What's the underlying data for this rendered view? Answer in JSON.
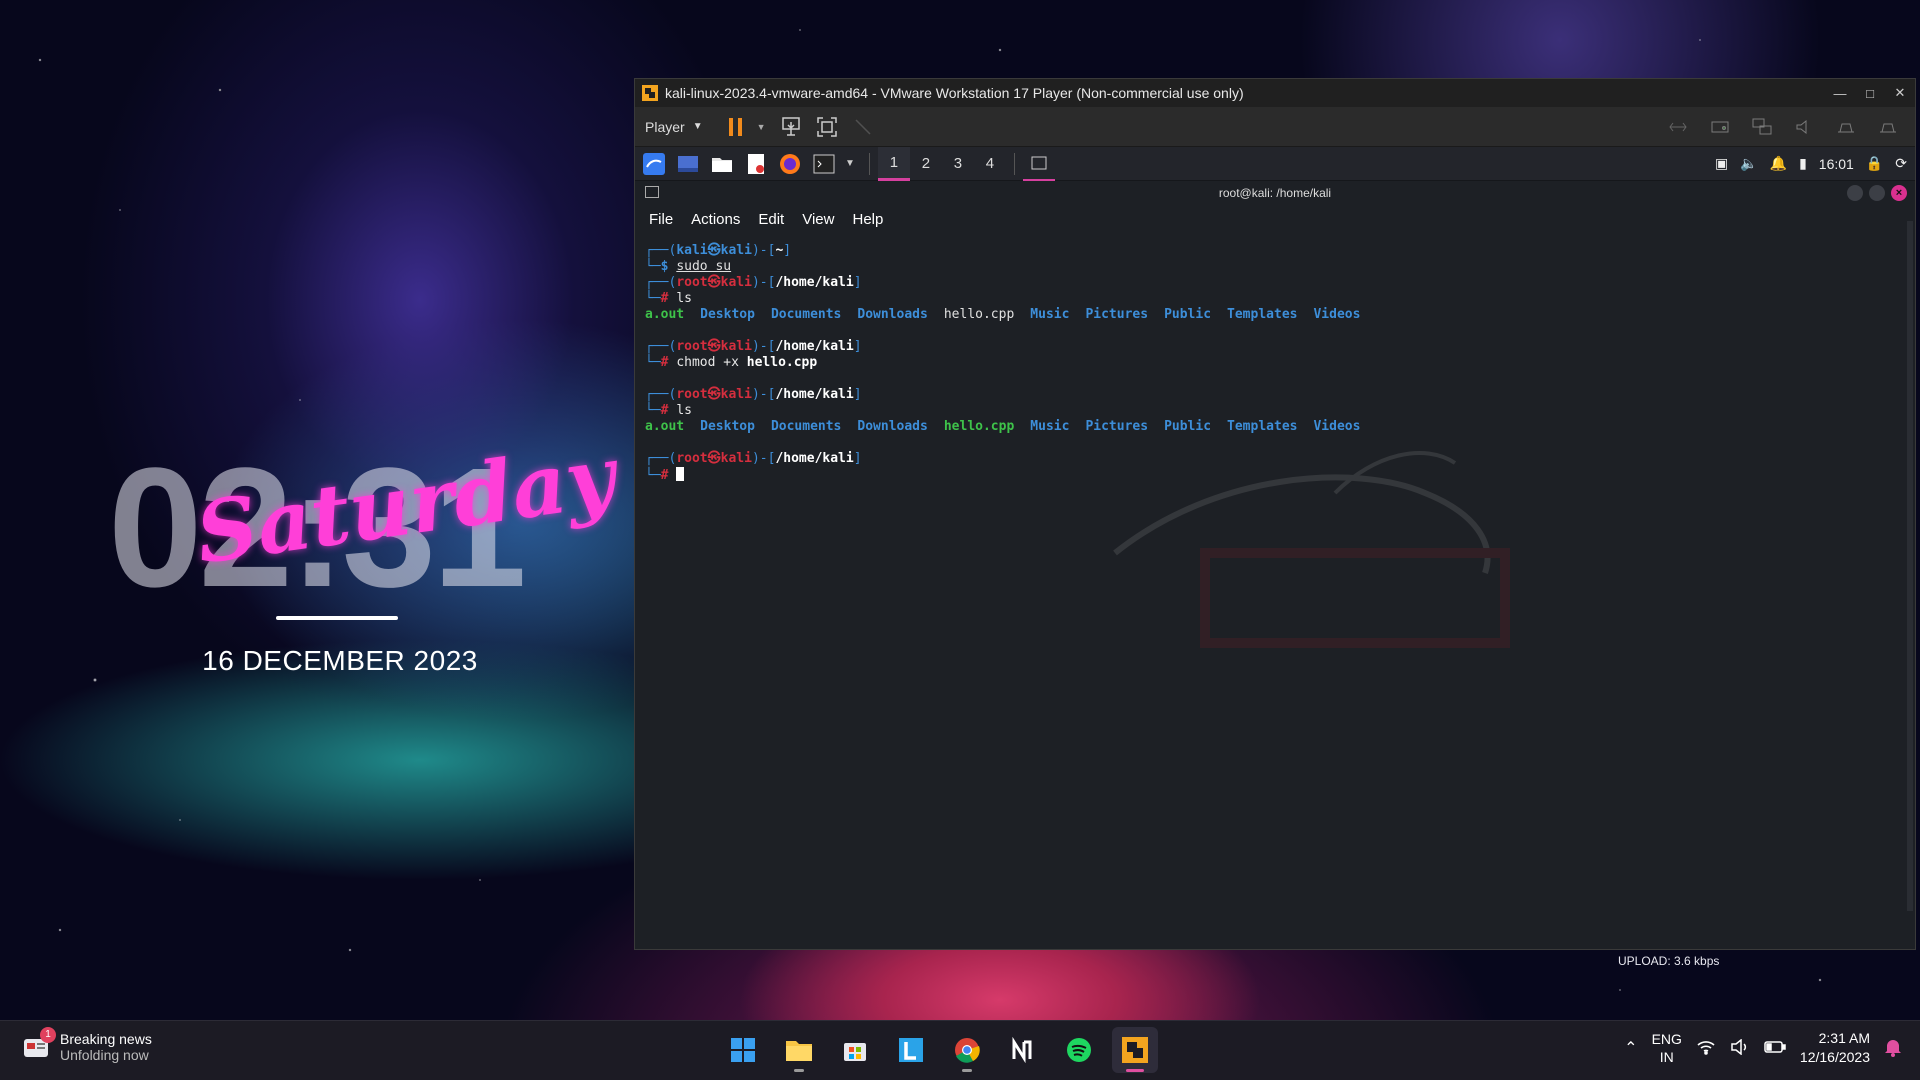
{
  "wallpaper": {
    "big_time": "02:31",
    "day": "Saturday",
    "date": "16 DECEMBER 2023",
    "upload": "UPLOAD: 3.6 kbps"
  },
  "vmware": {
    "title": "kali-linux-2023.4-vmware-amd64 - VMware Workstation 17 Player (Non-commercial use only)",
    "player_label": "Player"
  },
  "kali_panel": {
    "workspaces": [
      "1",
      "2",
      "3",
      "4"
    ],
    "time": "16:01"
  },
  "terminal": {
    "title": "root@kali: /home/kali",
    "menu": [
      "File",
      "Actions",
      "Edit",
      "View",
      "Help"
    ],
    "user_kali": "kali",
    "user_root": "root",
    "host": "kali",
    "home_path": "~",
    "root_path": "/home/kali",
    "cmd1": "sudo su",
    "cmd2": "ls",
    "cmd3_a": "chmod",
    "cmd3_b": "+x",
    "cmd3_c": "hello.cpp",
    "cmd4": "ls",
    "ls1": [
      {
        "name": "a.out",
        "type": "exe"
      },
      {
        "name": "Desktop",
        "type": "dir"
      },
      {
        "name": "Documents",
        "type": "dir"
      },
      {
        "name": "Downloads",
        "type": "dir"
      },
      {
        "name": "hello.cpp",
        "type": "file"
      },
      {
        "name": "Music",
        "type": "dir"
      },
      {
        "name": "Pictures",
        "type": "dir"
      },
      {
        "name": "Public",
        "type": "dir"
      },
      {
        "name": "Templates",
        "type": "dir"
      },
      {
        "name": "Videos",
        "type": "dir"
      }
    ],
    "ls2": [
      {
        "name": "a.out",
        "type": "exe"
      },
      {
        "name": "Desktop",
        "type": "dir"
      },
      {
        "name": "Documents",
        "type": "dir"
      },
      {
        "name": "Downloads",
        "type": "dir"
      },
      {
        "name": "hello.cpp",
        "type": "exe"
      },
      {
        "name": "Music",
        "type": "dir"
      },
      {
        "name": "Pictures",
        "type": "dir"
      },
      {
        "name": "Public",
        "type": "dir"
      },
      {
        "name": "Templates",
        "type": "dir"
      },
      {
        "name": "Videos",
        "type": "dir"
      }
    ]
  },
  "taskbar": {
    "news_title": "Breaking news",
    "news_sub": "Unfolding now",
    "news_badge": "1",
    "lang_1": "ENG",
    "lang_2": "IN",
    "time": "2:31 AM",
    "date": "12/16/2023"
  },
  "colors": {
    "kali_blue": "#3d8ed9",
    "root_red": "#d52e3e",
    "exec_green": "#3ec24a",
    "accent_pink": "#d6409f"
  }
}
